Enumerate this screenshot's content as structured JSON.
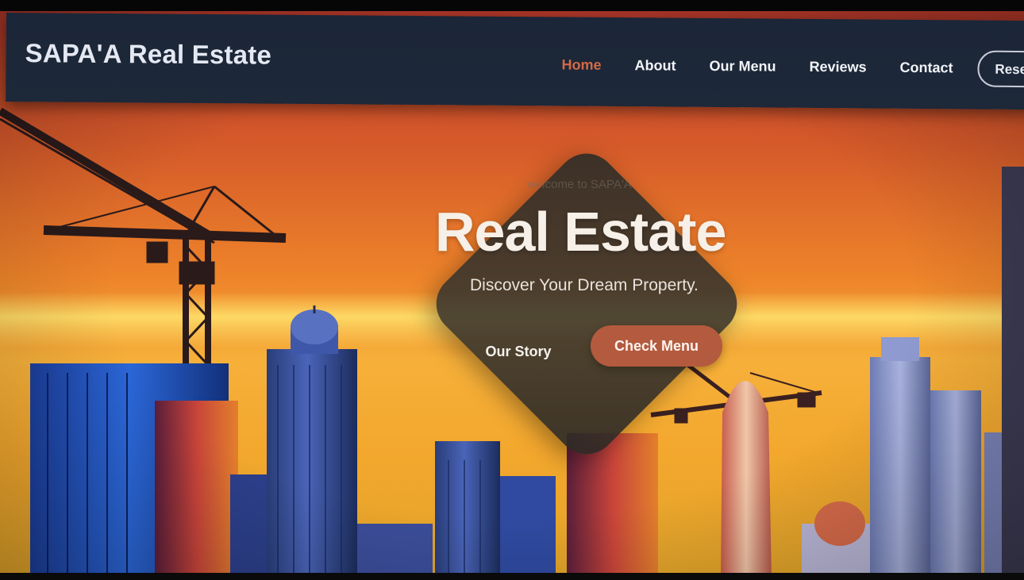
{
  "nav": {
    "brand": "SAPA'A Real Estate",
    "links": [
      "Home",
      "About",
      "Our Menu",
      "Reviews",
      "Contact"
    ],
    "active": "Home",
    "reserve_label": "Rese"
  },
  "hero": {
    "welcome": "welcome to SAPA'A",
    "title": "Real Estate",
    "subtitle": "Discover Your Dream Property.",
    "primary_cta": "Our Story",
    "secondary_cta": "Check Menu"
  },
  "colors": {
    "nav_bg": "#1d2839",
    "nav_active": "#d46a45",
    "cta_accent": "#b45a3e",
    "diamond_overlay": "#3a3630",
    "sky_top": "#b4362b",
    "sky_bottom": "#f6b03a"
  }
}
